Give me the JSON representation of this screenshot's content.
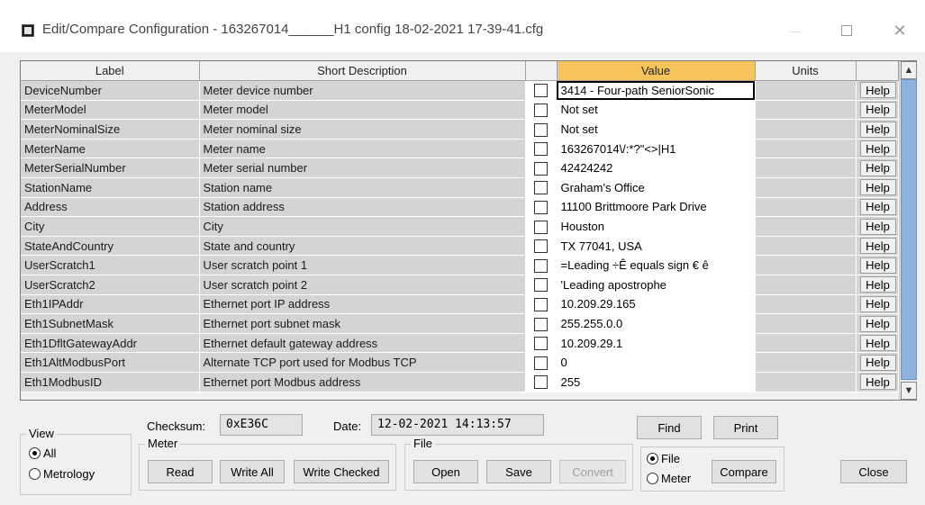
{
  "window": {
    "title": "Edit/Compare Configuration - 163267014______H1 config 18-02-2021 17-39-41.cfg",
    "minimize_glyph": "—",
    "close_glyph": "✕"
  },
  "grid": {
    "columns": {
      "label": "Label",
      "short_description": "Short Description",
      "check": "",
      "value": "Value",
      "units": "Units",
      "help": ""
    },
    "rows": [
      {
        "label": "DeviceNumber",
        "desc": "Meter device number",
        "value": "3414 - Four-path SeniorSonic",
        "units": "",
        "help": "Help",
        "selected": true
      },
      {
        "label": "MeterModel",
        "desc": "Meter model",
        "value": "Not set",
        "units": "",
        "help": "Help"
      },
      {
        "label": "MeterNominalSize",
        "desc": "Meter nominal size",
        "value": "Not set",
        "units": "",
        "help": "Help"
      },
      {
        "label": "MeterName",
        "desc": "Meter name",
        "value": "163267014\\/:*?\"<>|H1",
        "units": "",
        "help": "Help"
      },
      {
        "label": "MeterSerialNumber",
        "desc": "Meter serial number",
        "value": "42424242",
        "units": "",
        "help": "Help"
      },
      {
        "label": "StationName",
        "desc": "Station name",
        "value": "Graham's Office",
        "units": "",
        "help": "Help"
      },
      {
        "label": "Address",
        "desc": "Station address",
        "value": "11100 Brittmoore Park Drive",
        "units": "",
        "help": "Help"
      },
      {
        "label": "City",
        "desc": "City",
        "value": "Houston",
        "units": "",
        "help": "Help"
      },
      {
        "label": "StateAndCountry",
        "desc": "State and country",
        "value": "TX 77041, USA",
        "units": "",
        "help": "Help"
      },
      {
        "label": "UserScratch1",
        "desc": "User scratch point 1",
        "value": "=Leading ÷Ê equals sign € ê",
        "units": "",
        "help": "Help"
      },
      {
        "label": "UserScratch2",
        "desc": "User scratch point 2",
        "value": "'Leading apostrophe",
        "units": "",
        "help": "Help"
      },
      {
        "label": "Eth1IPAddr",
        "desc": "Ethernet port IP address",
        "value": "10.209.29.165",
        "units": "",
        "help": "Help"
      },
      {
        "label": "Eth1SubnetMask",
        "desc": "Ethernet port subnet mask",
        "value": "255.255.0.0",
        "units": "",
        "help": "Help"
      },
      {
        "label": "Eth1DfltGatewayAddr",
        "desc": "Ethernet default gateway address",
        "value": "10.209.29.1",
        "units": "",
        "help": "Help"
      },
      {
        "label": "Eth1AltModbusPort",
        "desc": "Alternate TCP port used for Modbus TCP",
        "value": "0",
        "units": "",
        "help": "Help"
      },
      {
        "label": "Eth1ModbusID",
        "desc": "Ethernet port Modbus address",
        "value": "255",
        "units": "",
        "help": "Help"
      }
    ]
  },
  "bottom": {
    "checksum_label": "Checksum:",
    "checksum_value": "0xE36C",
    "date_label": "Date:",
    "date_value": "12-02-2021 14:13:57",
    "view": {
      "title": "View",
      "options": [
        {
          "label": "All",
          "selected": true
        },
        {
          "label": "Metrology",
          "selected": false
        }
      ]
    },
    "meter": {
      "title": "Meter",
      "read": "Read",
      "write_all": "Write All",
      "write_checked": "Write Checked"
    },
    "file": {
      "title": "File",
      "open": "Open",
      "save": "Save",
      "convert": "Convert"
    },
    "find": "Find",
    "print": "Print",
    "compare_source": {
      "options": [
        {
          "label": "File",
          "selected": true
        },
        {
          "label": "Meter",
          "selected": false
        }
      ]
    },
    "compare": "Compare",
    "close": "Close"
  }
}
